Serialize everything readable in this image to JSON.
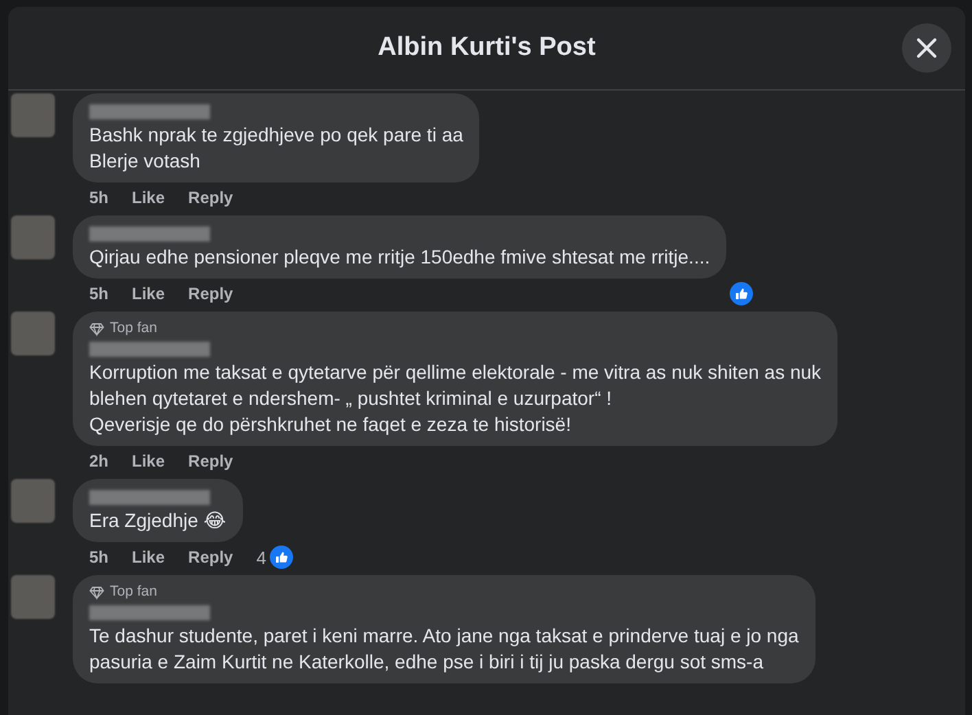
{
  "dialog": {
    "title": "Albin Kurti's Post"
  },
  "comments": [
    {
      "text": "Bashk nprak te zgjedhjeve po qek pare ti aa\nBlerje votash",
      "time": "5h",
      "like": "Like",
      "reply": "Reply"
    },
    {
      "text": "Qirjau edhe pensioner pleqve me rritje 150edhe fmive shtesat me rritje....",
      "time": "5h",
      "like": "Like",
      "reply": "Reply",
      "reaction": {
        "kind": "corner"
      }
    },
    {
      "badge": "Top fan",
      "text": "Korruption me taksat e qytetarve për qellime elektorale - me vitra as nuk shiten as nuk\nblehen qytetaret e ndershem- „ pushtet kriminal e uzurpator“ !\nQeverisje qe do përshkruhet ne faqet e zeza te historisë!",
      "time": "2h",
      "like": "Like",
      "reply": "Reply"
    },
    {
      "text": "Era Zgjedhje 😂",
      "time": "5h",
      "like": "Like",
      "reply": "Reply",
      "reaction": {
        "kind": "inline",
        "count": "4"
      }
    },
    {
      "badge": "Top fan",
      "text": "Te dashur studente, paret i keni marre. Ato jane nga taksat e prinderve tuaj e jo nga\npasuria e Zaim Kurtit ne Katerkolle, edhe pse i biri i tij ju paska dergu sot sms-a"
    }
  ]
}
